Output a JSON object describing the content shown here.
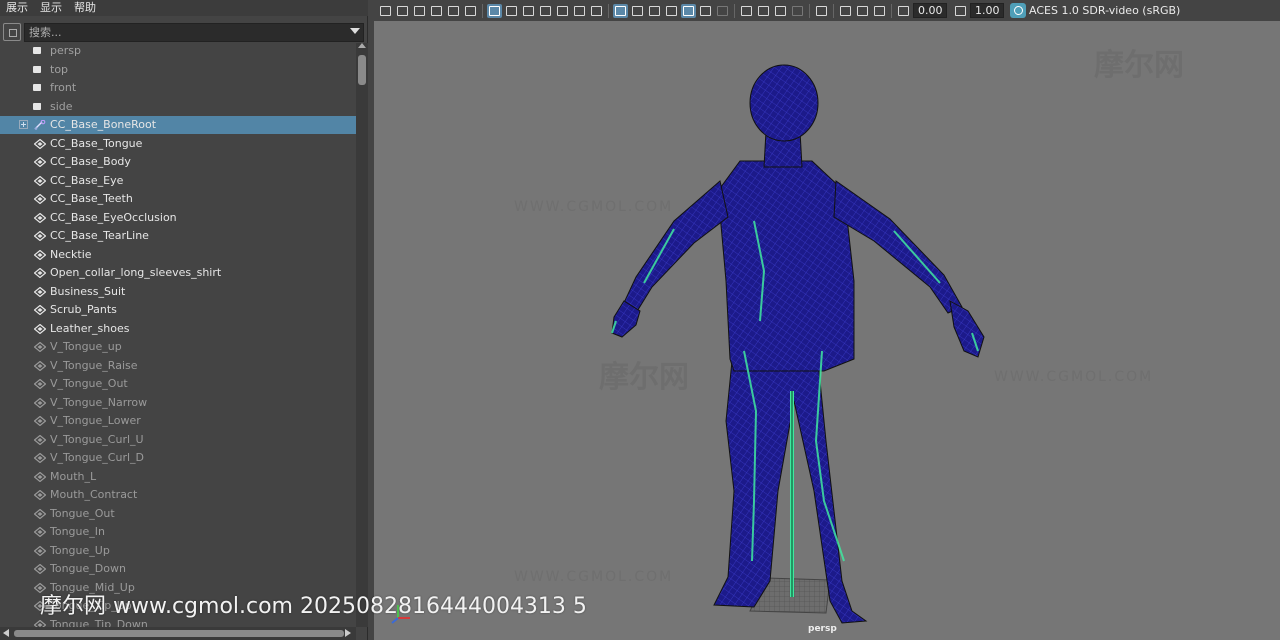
{
  "menu": {
    "items": [
      "展示",
      "显示",
      "帮助"
    ]
  },
  "outliner": {
    "search_placeholder": "搜索...",
    "items": [
      {
        "label": "persp",
        "kind": "camera"
      },
      {
        "label": "top",
        "kind": "camera"
      },
      {
        "label": "front",
        "kind": "camera"
      },
      {
        "label": "side",
        "kind": "camera"
      },
      {
        "label": "CC_Base_BoneRoot",
        "kind": "joint",
        "selected": true,
        "expandable": true
      },
      {
        "label": "CC_Base_Tongue",
        "kind": "transform"
      },
      {
        "label": "CC_Base_Body",
        "kind": "transform"
      },
      {
        "label": "CC_Base_Eye",
        "kind": "transform"
      },
      {
        "label": "CC_Base_Teeth",
        "kind": "transform"
      },
      {
        "label": "CC_Base_EyeOcclusion",
        "kind": "transform"
      },
      {
        "label": "CC_Base_TearLine",
        "kind": "transform"
      },
      {
        "label": "Necktie",
        "kind": "transform"
      },
      {
        "label": "Open_collar_long_sleeves_shirt",
        "kind": "transform"
      },
      {
        "label": "Business_Suit",
        "kind": "transform"
      },
      {
        "label": "Scrub_Pants",
        "kind": "transform"
      },
      {
        "label": "Leather_shoes",
        "kind": "transform"
      },
      {
        "label": "V_Tongue_up",
        "kind": "transform",
        "dim": true
      },
      {
        "label": "V_Tongue_Raise",
        "kind": "transform",
        "dim": true
      },
      {
        "label": "V_Tongue_Out",
        "kind": "transform",
        "dim": true
      },
      {
        "label": "V_Tongue_Narrow",
        "kind": "transform",
        "dim": true
      },
      {
        "label": "V_Tongue_Lower",
        "kind": "transform",
        "dim": true
      },
      {
        "label": "V_Tongue_Curl_U",
        "kind": "transform",
        "dim": true
      },
      {
        "label": "V_Tongue_Curl_D",
        "kind": "transform",
        "dim": true
      },
      {
        "label": "Mouth_L",
        "kind": "transform",
        "dim": true
      },
      {
        "label": "Mouth_Contract",
        "kind": "transform",
        "dim": true
      },
      {
        "label": "Tongue_Out",
        "kind": "transform",
        "dim": true
      },
      {
        "label": "Tongue_In",
        "kind": "transform",
        "dim": true
      },
      {
        "label": "Tongue_Up",
        "kind": "transform",
        "dim": true
      },
      {
        "label": "Tongue_Down",
        "kind": "transform",
        "dim": true
      },
      {
        "label": "Tongue_Mid_Up",
        "kind": "transform",
        "dim": true
      },
      {
        "label": "Tongue_Tip_Up",
        "kind": "transform",
        "dim": true
      },
      {
        "label": "Tongue_Tip_Down",
        "kind": "transform",
        "dim": true
      }
    ]
  },
  "viewport": {
    "exposure": "0.00",
    "gamma": "1.00",
    "color_space": "ACES 1.0 SDR-video (sRGB)",
    "camera": "persp",
    "colors": {
      "background": "#767676",
      "wire": "#1a1a8c",
      "highlight": "#40e8a0",
      "selection": "#5285a6"
    }
  },
  "watermarks": {
    "cn": "摩尔网",
    "en": "WWW.CGMOL.COM",
    "bottom": "摩尔网 www.cgmol.com 2025082816444004313 5"
  }
}
